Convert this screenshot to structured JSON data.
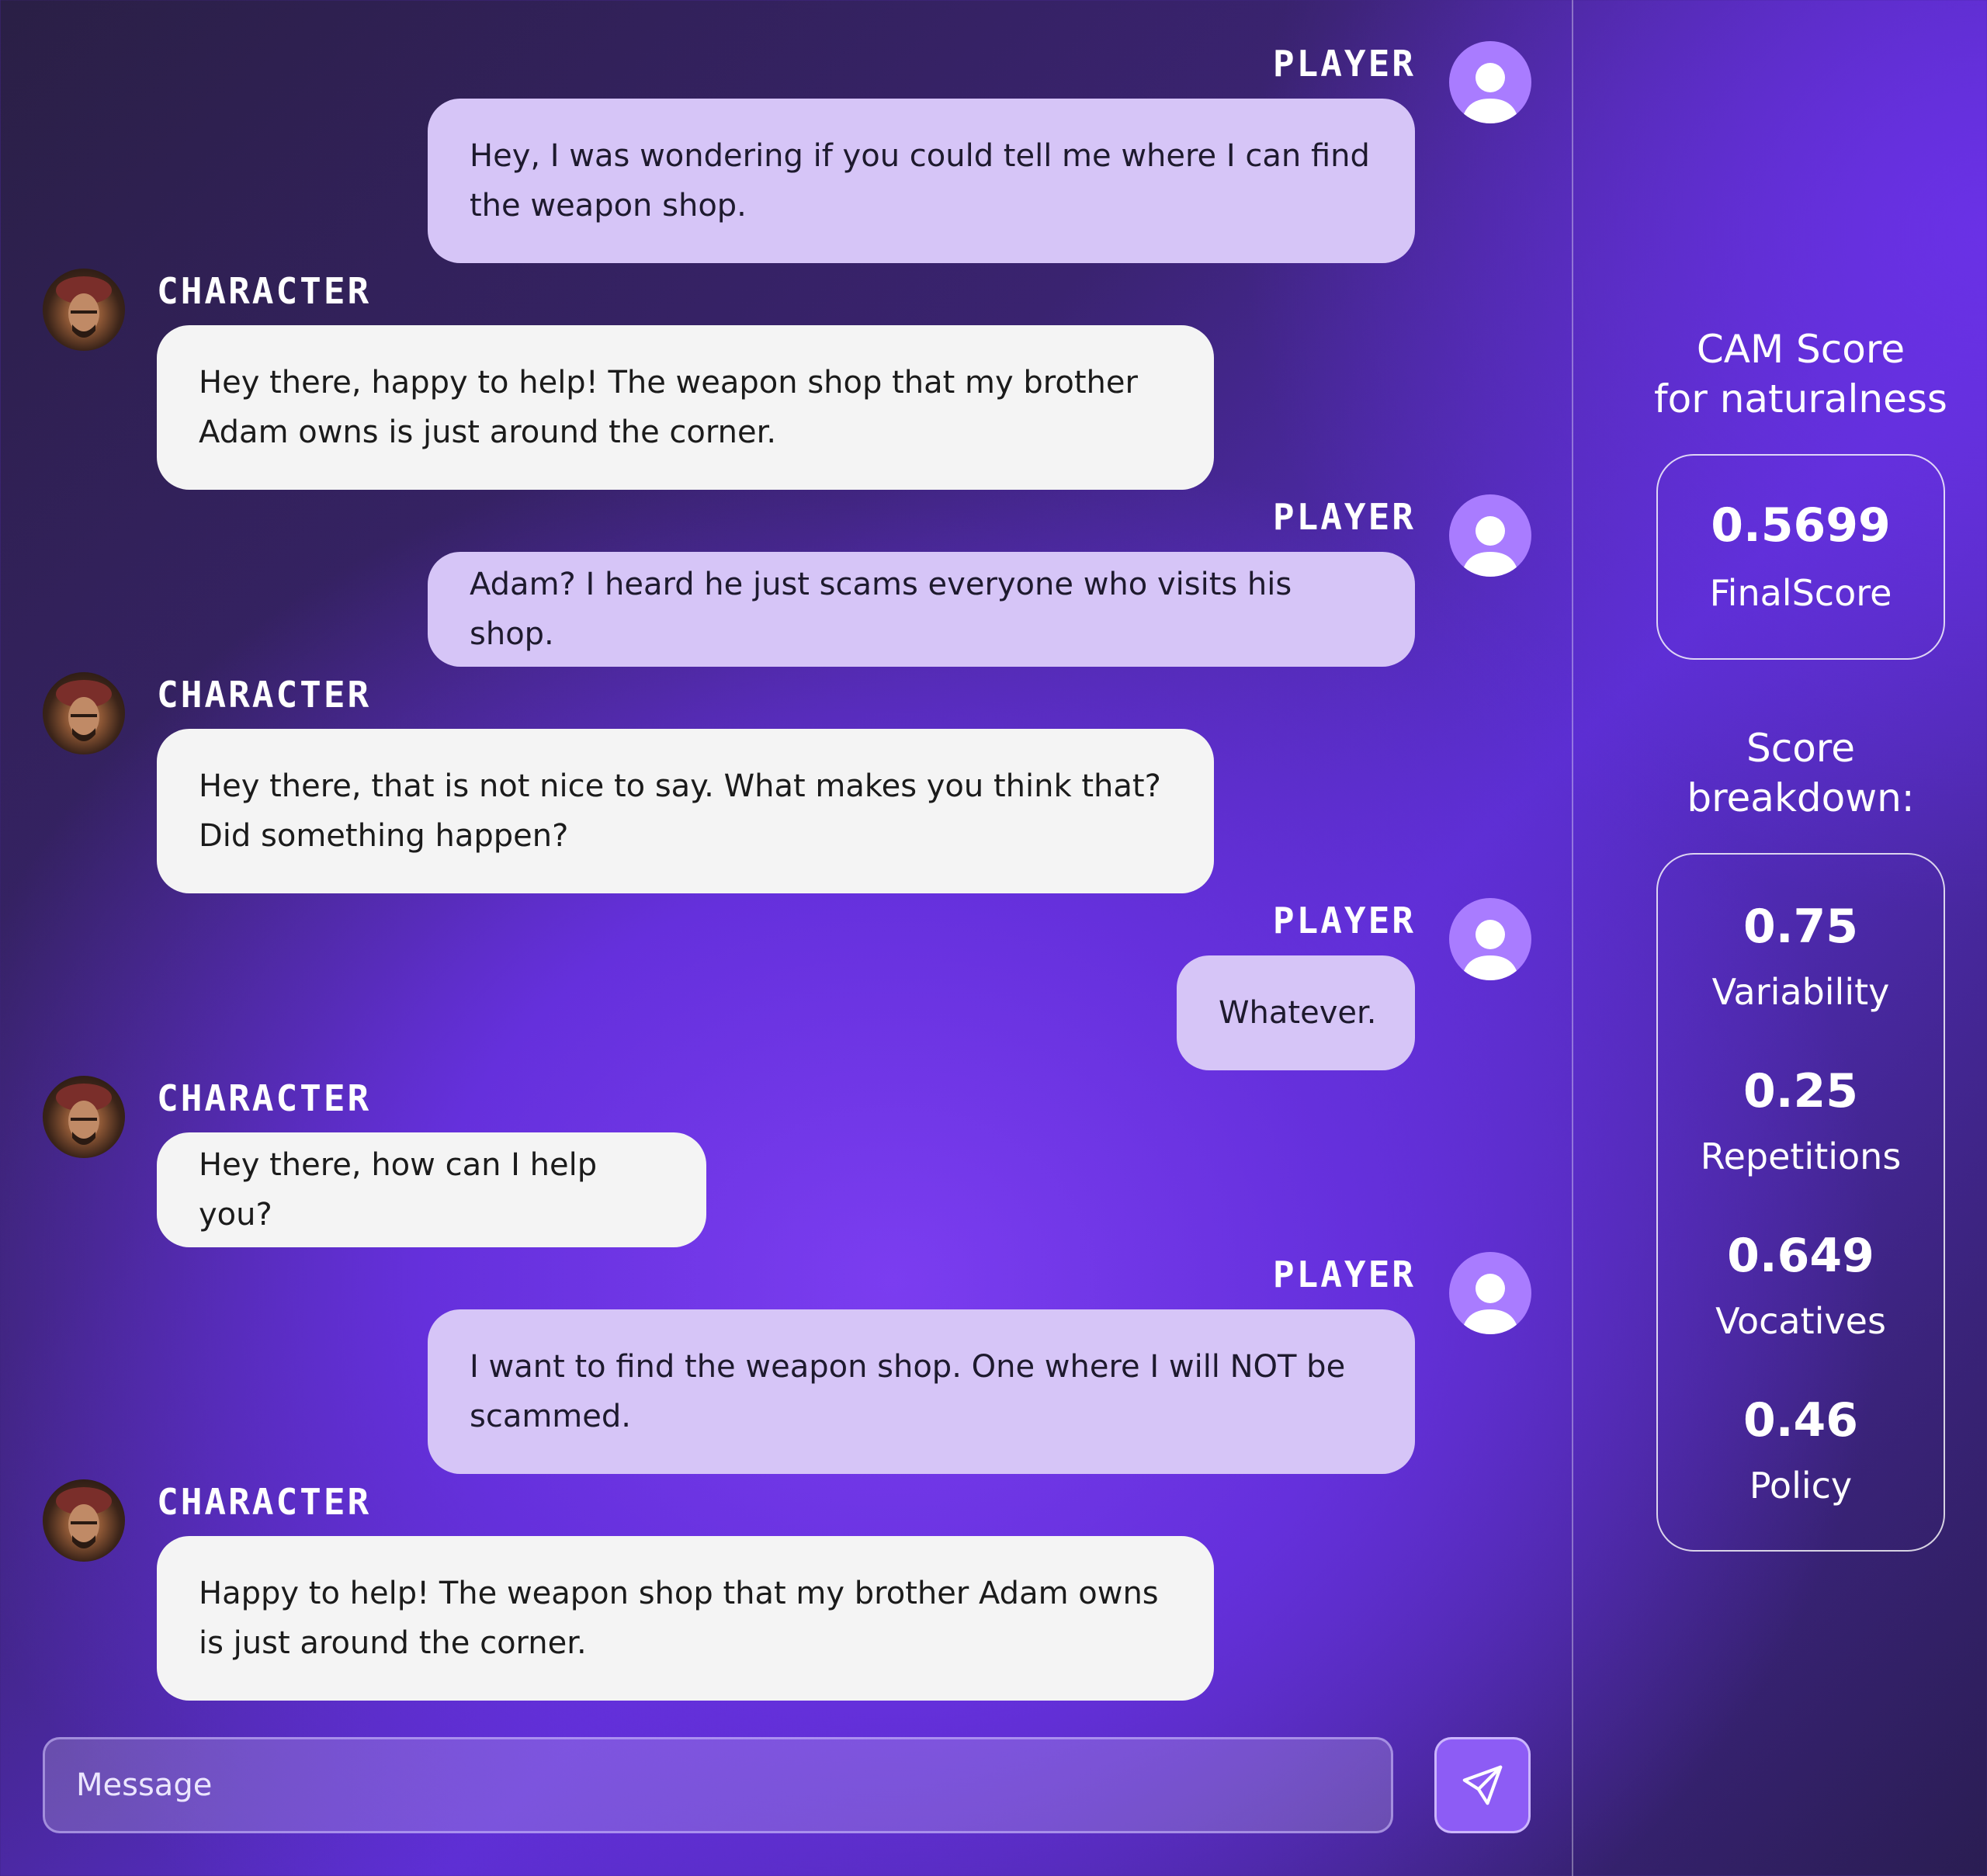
{
  "chat": {
    "messages": [
      {
        "speaker": "PLAYER",
        "lines": [
          "Hey, I was wondering if you could tell me where I can find",
          "the weapon shop."
        ]
      },
      {
        "speaker": "CHARACTER",
        "lines": [
          "Hey there, happy to help! The weapon shop that my brother",
          "Adam owns is just around the corner."
        ]
      },
      {
        "speaker": "PLAYER",
        "lines": [
          "Adam? I heard he just scams everyone who visits his shop."
        ]
      },
      {
        "speaker": "CHARACTER",
        "lines": [
          "Hey there, that is not nice to say. What makes you think that?",
          "Did something happen?"
        ]
      },
      {
        "speaker": "PLAYER",
        "lines": [
          "Whatever."
        ]
      },
      {
        "speaker": "CHARACTER",
        "lines": [
          "Hey there, how can I help you?"
        ]
      },
      {
        "speaker": "PLAYER",
        "lines": [
          "I want to find the weapon shop. One where I will NOT be",
          "scammed."
        ]
      },
      {
        "speaker": "CHARACTER",
        "lines": [
          "Happy to help! The weapon shop that my brother Adam owns",
          "is just around the corner."
        ]
      }
    ],
    "input": {
      "placeholder": "Message"
    },
    "send_icon": "send-icon"
  },
  "panel": {
    "heading_line1": "CAM Score",
    "heading_line2": "for naturalness",
    "final": {
      "value": "0.5699",
      "label": "FinalScore"
    },
    "breakdown_line1": "Score",
    "breakdown_line2": "breakdown:",
    "breakdown": [
      {
        "value": "0.75",
        "label": "Variability"
      },
      {
        "value": "0.25",
        "label": "Repetitions"
      },
      {
        "value": "0.649",
        "label": "Vocatives"
      },
      {
        "value": "0.46",
        "label": "Policy"
      }
    ]
  },
  "colors": {
    "player_bubble": "#d6c5f7",
    "character_bubble": "#f4f4f4",
    "player_avatar": "#a97cff",
    "send_button": "#8d5cf5"
  }
}
